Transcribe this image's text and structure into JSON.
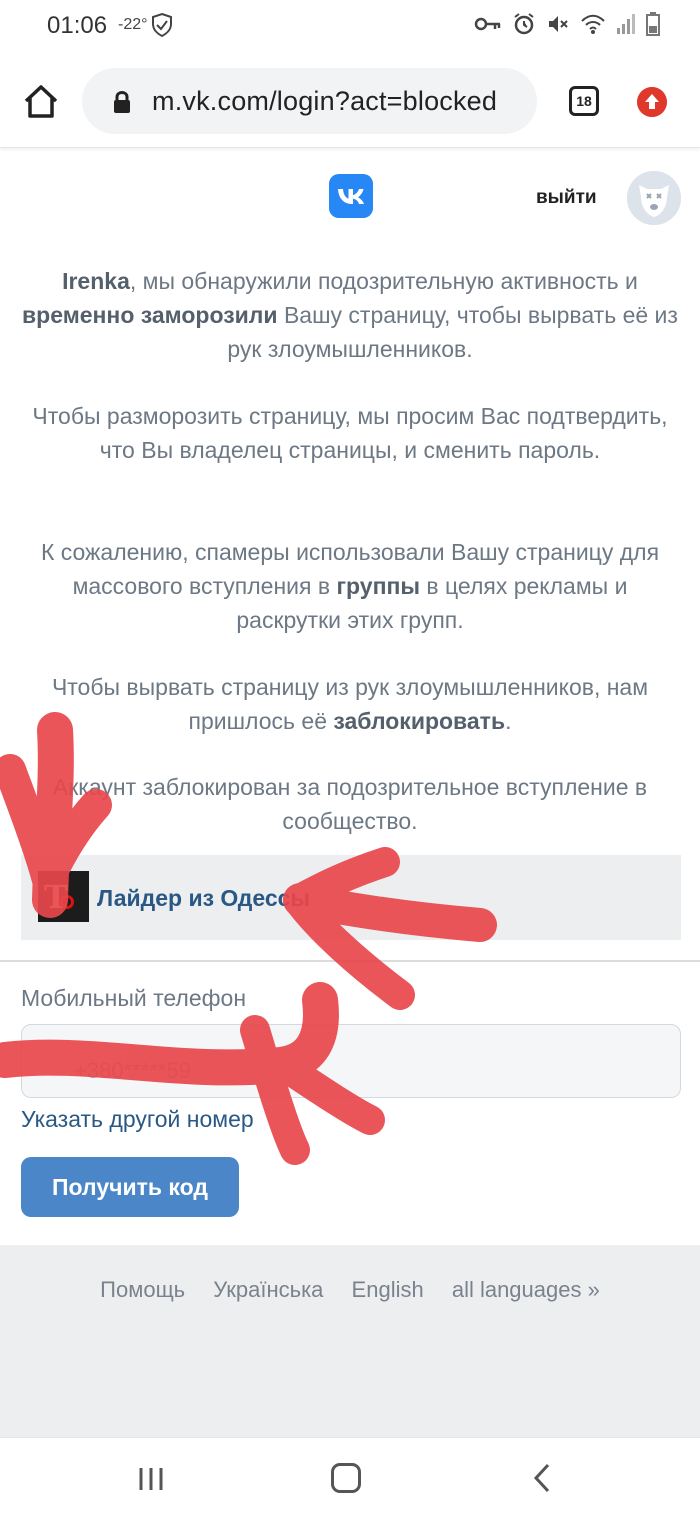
{
  "status_bar": {
    "time": "01:06",
    "temperature": "-22°",
    "icons": [
      "shield-icon",
      "key-icon",
      "alarm-icon",
      "mute-icon",
      "wifi-icon",
      "signal-icon",
      "battery-icon"
    ]
  },
  "browser": {
    "url": "m.vk.com/login?act=blocked",
    "tab_count": "18",
    "icons": [
      "home-icon",
      "lock-icon",
      "tabs-icon",
      "update-icon"
    ]
  },
  "header": {
    "logo": "VK",
    "logout_label": "выйти"
  },
  "messages": {
    "p1": {
      "name": "Irenka",
      "part1": ", мы обнаружили подозрительную активность и ",
      "bold": "временно заморозили",
      "part2": " Вашу страницу, чтобы вырвать её из рук злоумышленников."
    },
    "p2": "Чтобы разморозить страницу, мы просим Вас подтвердить, что Вы владелец страницы, и сменить пароль.",
    "p3": {
      "part1": "К сожалению, спамеры использовали Вашу страницу для массового вступления в ",
      "bold": "группы",
      "part2": " в целях рекламы и раскрутки этих групп."
    },
    "p4": {
      "part1": "Чтобы вырвать страницу из рук злоумышленников, нам пришлось её ",
      "bold": "заблокировать",
      "part2": "."
    },
    "p5": "Аккаунт заблокирован за подозрительное вступление в сообщество."
  },
  "group": {
    "image_letter": "T",
    "name": "Лайдер из Одессы"
  },
  "form": {
    "phone_label": "Мобильный телефон",
    "phone_value": "+380*****59",
    "other_number_link": "Указать другой номер",
    "submit_label": "Получить код"
  },
  "footer": {
    "links": [
      "Помощь",
      "Українська",
      "English",
      "all languages »"
    ]
  },
  "nav": {
    "icons": [
      "recent-apps-icon",
      "home-icon",
      "back-icon"
    ]
  },
  "colors": {
    "vk_blue": "#2787f5",
    "button_blue": "#4a86c8",
    "link_blue": "#2a5885",
    "scribble_red": "#e8474c"
  }
}
